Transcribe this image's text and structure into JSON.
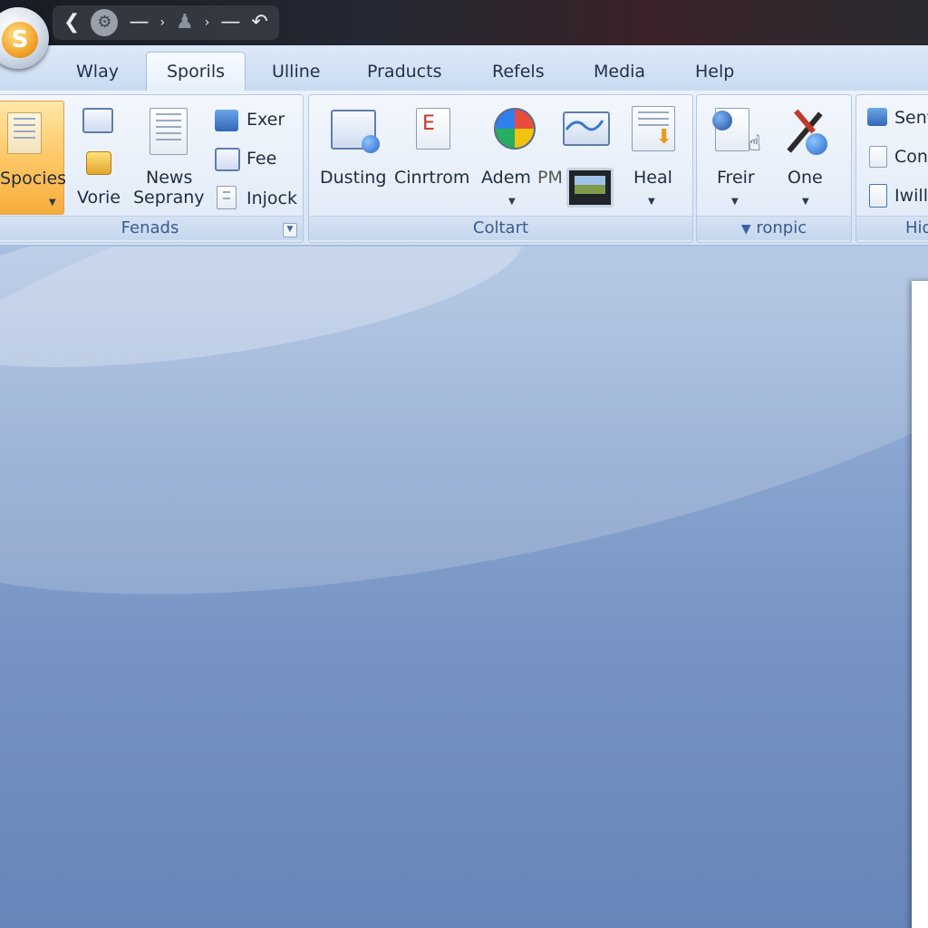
{
  "titlebar": {
    "quick_access": [
      "back-icon",
      "gear-icon",
      "dash-icon",
      "mini-arrow-icon",
      "figure-icon",
      "mini-arrow-icon",
      "dash-icon",
      "undo-icon"
    ]
  },
  "tabs": [
    {
      "label": "Wlay"
    },
    {
      "label": "Sporils",
      "active": true
    },
    {
      "label": "Ulline"
    },
    {
      "label": "Praducts"
    },
    {
      "label": "Refels"
    },
    {
      "label": "Media"
    },
    {
      "label": "Help"
    }
  ],
  "ribbon": {
    "group1": {
      "label": "Fenads",
      "species": "Spocies",
      "vorie": "Vorie",
      "news": "News",
      "seprany": "Seprany",
      "exer": "Exer",
      "fee": "Fee",
      "injock": "Injock"
    },
    "group2": {
      "label": "Coltart",
      "dusting": "Dusting",
      "cinrtrom": "Cinrtrom",
      "adem": "Adem",
      "pm": "PM",
      "heal": "Heal"
    },
    "group3": {
      "label": "ronpic",
      "freir": "Freir",
      "one": "One"
    },
    "group4": {
      "label": "Hid",
      "item1": "Sent",
      "item2": "Con",
      "item3": "Iwill"
    }
  },
  "colors": {
    "accent": "#ffc766",
    "ribbon": "#dfe9f6",
    "workspace": "#7592c2"
  }
}
